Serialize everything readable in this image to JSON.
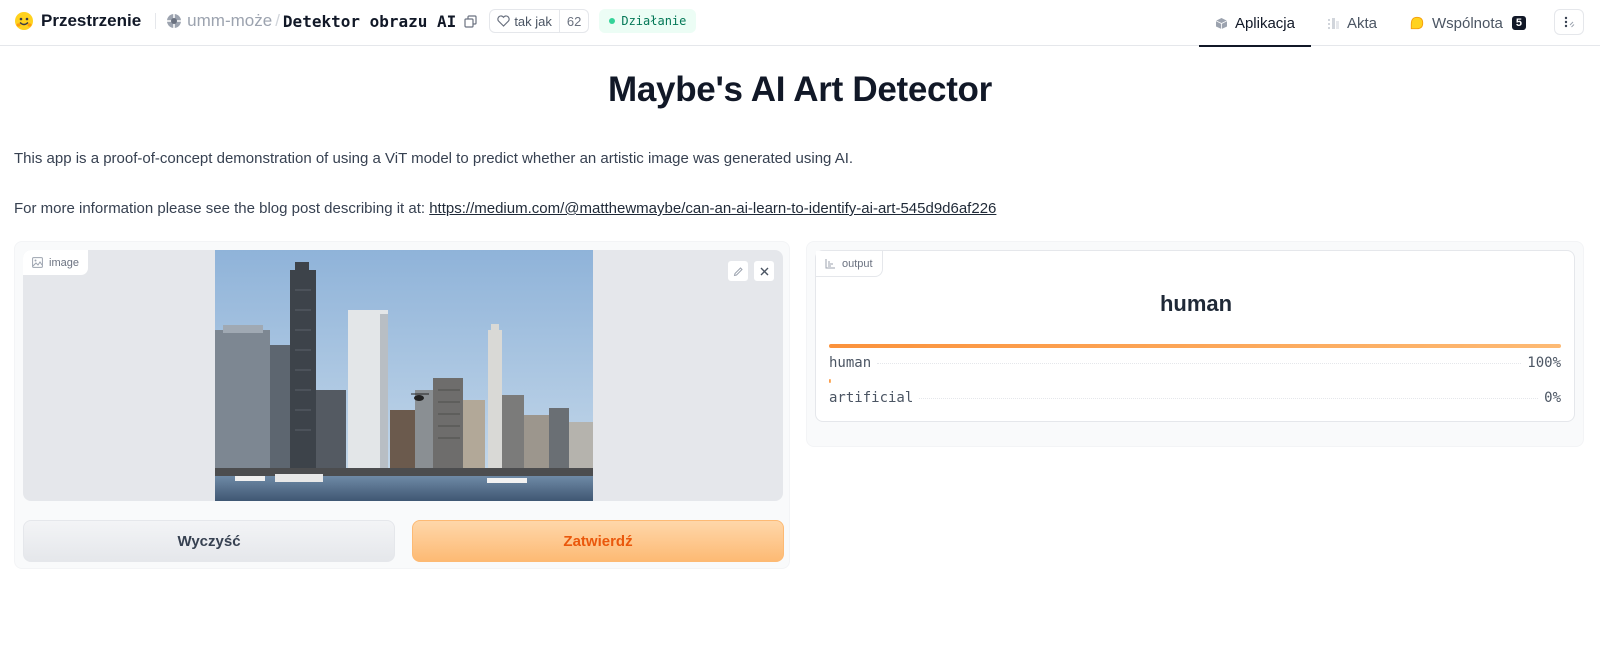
{
  "header": {
    "brand": "Przestrzenie",
    "org": "umm-może",
    "separator": "/",
    "space_name": "Detektor obrazu AI",
    "like_label": "tak jak",
    "like_count": "62",
    "status": "Działanie",
    "tabs": [
      {
        "label": "Aplikacja",
        "icon": "app-cube-icon",
        "active": true
      },
      {
        "label": "Akta",
        "icon": "files-icon",
        "active": false
      },
      {
        "label": "Wspólnota",
        "icon": "community-icon",
        "active": false,
        "badge": "5"
      }
    ]
  },
  "page": {
    "title": "Maybe's AI Art Detector",
    "description": "This app is a proof-of-concept demonstration of using a ViT model to predict whether an artistic image was generated using AI.",
    "info_prefix": "For more information please see the blog post describing it at: ",
    "info_link": "https://medium.com/@matthewmaybe/can-an-ai-learn-to-identify-ai-art-545d9d6af226"
  },
  "input": {
    "label": "image",
    "clear_button": "Wyczyść",
    "submit_button": "Zatwierdź"
  },
  "output": {
    "label": "output",
    "top_label": "human",
    "confidences": [
      {
        "label": "human",
        "value": "100%",
        "fraction": 1.0
      },
      {
        "label": "artificial",
        "value": "0%",
        "fraction": 0.0
      }
    ]
  },
  "colors": {
    "accent_orange": "#fb923c",
    "status_green": "#34d399"
  }
}
